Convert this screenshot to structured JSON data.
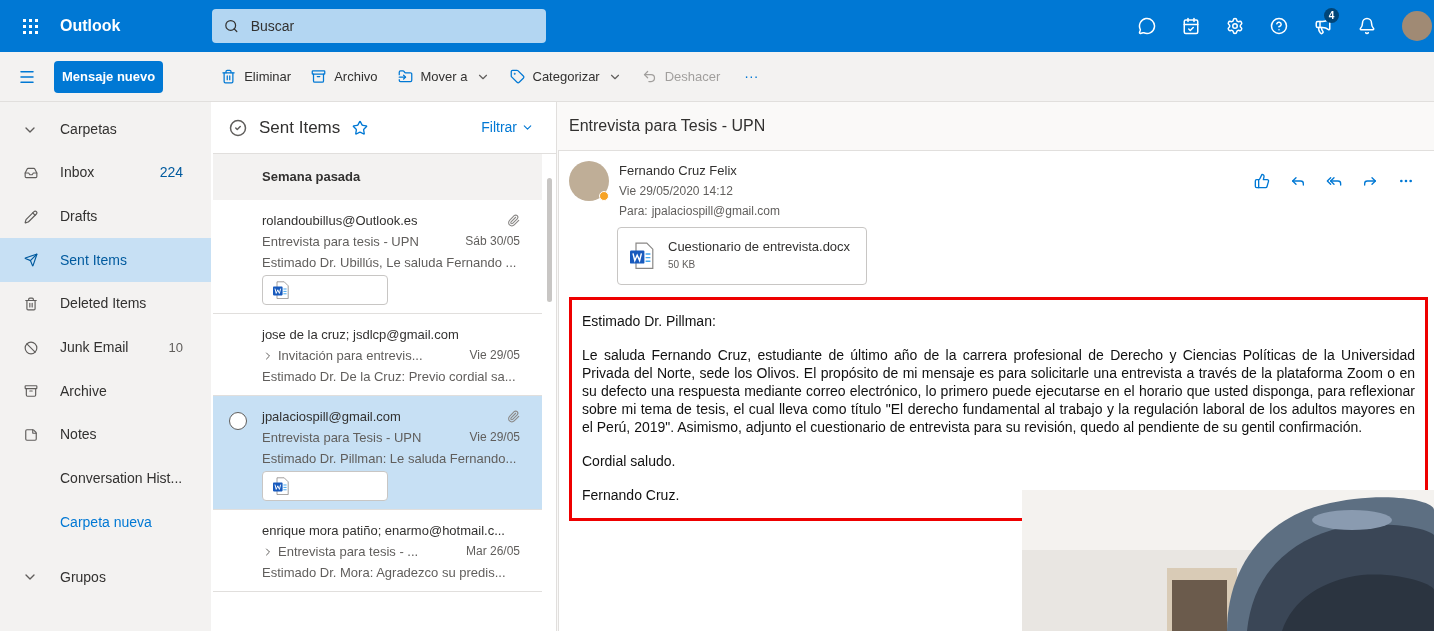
{
  "topbar": {
    "app_name": "Outlook",
    "search": {
      "placeholder": "Buscar"
    },
    "notification_badge": "4"
  },
  "toolbar": {
    "new_message": "Mensaje nuevo",
    "actions": [
      {
        "label": "Eliminar",
        "kind": "delete",
        "dropdown": false,
        "disabled": false
      },
      {
        "label": "Archivo",
        "kind": "archive",
        "dropdown": false,
        "disabled": false
      },
      {
        "label": "Mover a",
        "kind": "move",
        "dropdown": true,
        "disabled": false
      },
      {
        "label": "Categorizar",
        "kind": "tag",
        "dropdown": true,
        "disabled": false
      },
      {
        "label": "Deshacer",
        "kind": "undo",
        "dropdown": false,
        "disabled": true
      }
    ],
    "more": "···"
  },
  "sidebar": {
    "folders_header": "Carpetas",
    "folders": [
      {
        "name": "Inbox",
        "kind": "inbox",
        "count": "224",
        "unread": true,
        "selected": false
      },
      {
        "name": "Drafts",
        "kind": "drafts",
        "selected": false
      },
      {
        "name": "Sent Items",
        "kind": "sent",
        "selected": true
      },
      {
        "name": "Deleted Items",
        "kind": "deleted",
        "selected": false
      },
      {
        "name": "Junk Email",
        "kind": "junk",
        "count": "10",
        "unread": false,
        "selected": false
      },
      {
        "name": "Archive",
        "kind": "archive",
        "selected": false
      },
      {
        "name": "Notes",
        "kind": "notes",
        "selected": false
      },
      {
        "name": "Conversation Hist...",
        "kind": "plain",
        "selected": false
      }
    ],
    "new_folder": "Carpeta nueva",
    "groups_header": "Grupos"
  },
  "message_list": {
    "title": "Sent Items",
    "filter": "Filtrar",
    "group": "Semana pasada",
    "messages": [
      {
        "from": "rolandoubillus@Outlook.es",
        "subject": "Entrevista para tesis - UPN",
        "date": "Sáb 30/05",
        "preview": "Estimado Dr. Ubillús, Le saluda Fernando ...",
        "attachment": true,
        "thread": false,
        "selected": false
      },
      {
        "from": "jose de la cruz; jsdlcp@gmail.com",
        "subject": "Invitación para entrevis...",
        "date": "Vie 29/05",
        "preview": "Estimado Dr. De la Cruz: Previo cordial sa...",
        "attachment": false,
        "thread": true,
        "selected": false
      },
      {
        "from": "jpalaciospill@gmail.com",
        "subject": "Entrevista para Tesis - UPN",
        "date": "Vie 29/05",
        "preview": "Estimado Dr. Pillman: Le saluda Fernando...",
        "attachment": true,
        "thread": false,
        "selected": true
      },
      {
        "from": "enrique mora patiño; enarmo@hotmail.c...",
        "subject": "Entrevista para tesis - ...",
        "date": "Mar 26/05",
        "preview": "Estimado Dr. Mora: Agradezco su predis...",
        "attachment": false,
        "thread": true,
        "selected": false
      }
    ]
  },
  "reading_pane": {
    "subject": "Entrevista para Tesis - UPN",
    "sender": "Fernando Cruz Felix",
    "date": "Vie 29/05/2020 14:12",
    "to_label": "Para:",
    "to": "jpalaciospill@gmail.com",
    "attachment": {
      "name": "Cuestionario de entrevista.docx",
      "size": "50 KB"
    },
    "body": [
      "Estimado Dr. Pillman:",
      "Le saluda Fernando Cruz, estudiante de último año de la carrera profesional de Derecho y Ciencias Políticas de la Universidad Privada del Norte, sede los Olivos. El propósito de mi mensaje es para solicitarle una entrevista a través de la plataforma Zoom o en su defecto una respuesta mediante correo electrónico, lo primero puede ejecutarse en el horario que usted disponga, para reflexionar sobre mi tema de tesis, el cual lleva como título \"El derecho fundamental al trabajo y la regulación laboral de los adultos mayores en el Perú, 2019\". Asimismo, adjunto el cuestionario de entrevista para su revisión, quedo al pendiente de su gentil confirmación.",
      "Cordial saludo.",
      "Fernando Cruz."
    ],
    "camera_overlay": {
      "kind": "picture"
    }
  }
}
